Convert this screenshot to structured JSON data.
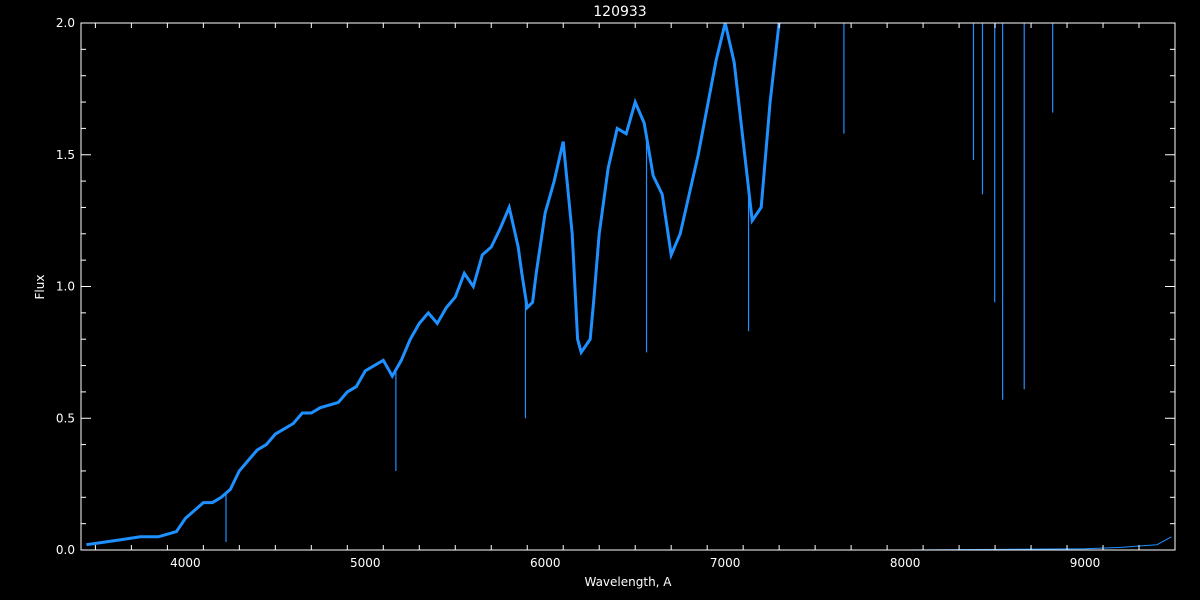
{
  "chart_data": {
    "type": "line",
    "title": "120933",
    "xlabel": "Wavelength, A",
    "ylabel": "Flux",
    "xlim": [
      3420,
      9500
    ],
    "ylim": [
      0,
      2.0
    ],
    "xticks": [
      4000,
      5000,
      6000,
      7000,
      8000,
      9000
    ],
    "yticks": [
      0.0,
      0.5,
      1.0,
      1.5,
      2.0
    ],
    "ytick_labels": [
      "0.0",
      "0.5",
      "1.0",
      "1.5",
      "2.0"
    ],
    "grid": false,
    "colors": {
      "series": "#1e90ff",
      "axes": "#ffffff",
      "background": "#000000"
    },
    "series": [
      {
        "x": [
          3450,
          3550,
          3650,
          3750,
          3850,
          3950,
          4000,
          4050,
          4100,
          4150,
          4200,
          4250,
          4300,
          4350,
          4400,
          4450,
          4500,
          4550,
          4600,
          4650,
          4700,
          4750,
          4800,
          4850,
          4900,
          4950,
          5000,
          5050,
          5100,
          5150,
          5200,
          5250,
          5300,
          5350,
          5400,
          5450,
          5500,
          5550,
          5600,
          5650,
          5700,
          5750,
          5800,
          5850,
          5870,
          5900,
          5930,
          5950,
          6000,
          6050,
          6100,
          6150,
          6180,
          6200,
          6250,
          6270,
          6300,
          6350,
          6400,
          6450,
          6500,
          6550,
          6600,
          6650,
          6700,
          6750,
          6800,
          6850,
          6900,
          6950,
          7000,
          7050,
          7100,
          7150,
          7200,
          7250,
          7300
        ],
        "y": [
          0.02,
          0.03,
          0.04,
          0.05,
          0.05,
          0.07,
          0.12,
          0.15,
          0.18,
          0.18,
          0.2,
          0.23,
          0.3,
          0.34,
          0.38,
          0.4,
          0.44,
          0.46,
          0.48,
          0.52,
          0.52,
          0.54,
          0.55,
          0.56,
          0.6,
          0.62,
          0.68,
          0.7,
          0.72,
          0.66,
          0.72,
          0.8,
          0.86,
          0.9,
          0.86,
          0.92,
          0.96,
          1.05,
          1.0,
          1.12,
          1.15,
          1.22,
          1.3,
          1.15,
          1.05,
          0.92,
          0.94,
          1.05,
          1.28,
          1.4,
          1.55,
          1.2,
          0.8,
          0.75,
          0.8,
          0.95,
          1.2,
          1.45,
          1.6,
          1.58,
          1.7,
          1.62,
          1.42,
          1.35,
          1.12,
          1.2,
          1.35,
          1.5,
          1.68,
          1.86,
          2.0,
          1.85,
          1.55,
          1.25,
          1.3,
          1.7,
          2.0
        ]
      }
    ],
    "absorption_lines": [
      {
        "x": 5890,
        "y": 0.5
      },
      {
        "x": 6563,
        "y": 0.75
      },
      {
        "x": 7130,
        "y": 0.83
      },
      {
        "x": 8498,
        "y": 0.94
      },
      {
        "x": 8542,
        "y": 0.57
      },
      {
        "x": 8662,
        "y": 0.61
      },
      {
        "x": 7660,
        "y": 1.58
      },
      {
        "x": 8380,
        "y": 1.48
      },
      {
        "x": 8430,
        "y": 1.35
      },
      {
        "x": 8820,
        "y": 1.66
      },
      {
        "x": 5170,
        "y": 0.3
      },
      {
        "x": 4226,
        "y": 0.03
      }
    ],
    "lower_trace": {
      "x": [
        3950,
        8000,
        9000,
        9200,
        9400,
        9480
      ],
      "y": [
        0.0,
        0.0,
        0.005,
        0.01,
        0.02,
        0.05
      ]
    }
  }
}
